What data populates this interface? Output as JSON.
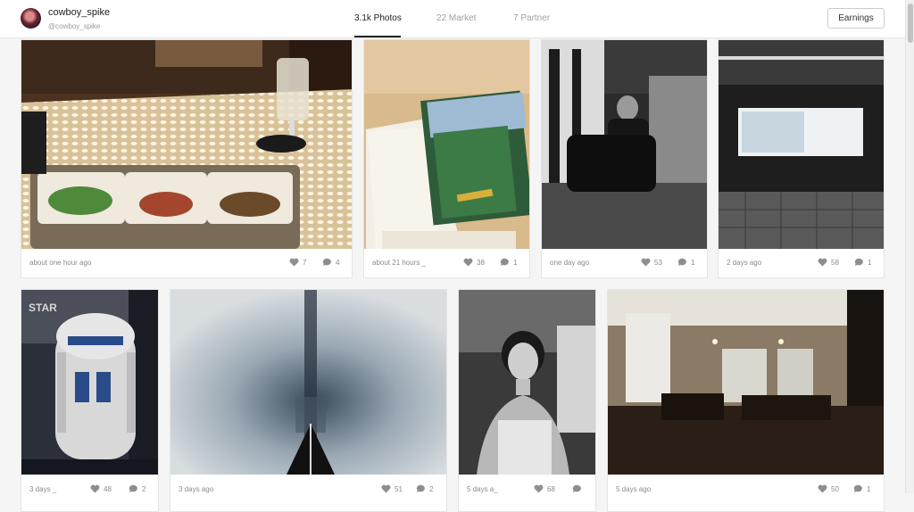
{
  "profile": {
    "username": "cowboy_spike",
    "handle": "@cowboy_spike"
  },
  "tabs": [
    {
      "label": "3.1k Photos"
    },
    {
      "label": "22 Market"
    },
    {
      "label": "7 Partner"
    }
  ],
  "earnings_label": "Earnings",
  "cards": [
    {
      "time": "about one hour ago",
      "likes": "7",
      "comments": "4"
    },
    {
      "time": "about 21 hours _",
      "likes": "38",
      "comments": "1"
    },
    {
      "time": "one day ago",
      "likes": "53",
      "comments": "1"
    },
    {
      "time": "2 days ago",
      "likes": "58",
      "comments": "1"
    },
    {
      "time": "3 days _",
      "likes": "48",
      "comments": "2"
    },
    {
      "time": "3 days ago",
      "likes": "51",
      "comments": "2"
    },
    {
      "time": "5 days a_",
      "likes": "68",
      "comments": ""
    },
    {
      "time": "5 days ago",
      "likes": "50",
      "comments": "1"
    }
  ]
}
